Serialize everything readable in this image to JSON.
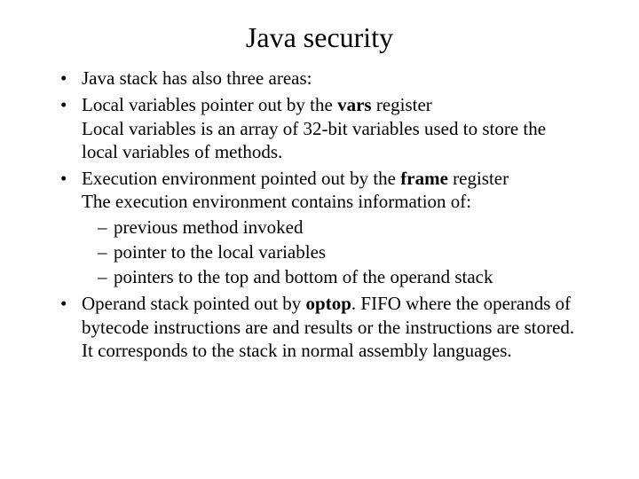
{
  "title": "Java security",
  "bullets": {
    "b1": "Java stack has also three areas:",
    "b2_before": "Local variables pointer out by the ",
    "b2_bold": "vars",
    "b2_after": " register",
    "b2_cont": "Local variables is an array of 32-bit variables used to store the local variables of methods.",
    "b3_before": "Execution environment pointed out by the ",
    "b3_bold": "frame",
    "b3_after": " register",
    "b3_cont": "The execution environment contains information of:",
    "b3_sub1": "previous method invoked",
    "b3_sub2": "pointer to the local variables",
    "b3_sub3": "pointers to the top and bottom of the operand stack",
    "b4_before": "Operand stack pointed out by ",
    "b4_bold": "optop",
    "b4_after": ". FIFO where the operands of bytecode instructions are and results or the instructions are stored. It corresponds to the stack in normal assembly languages."
  }
}
